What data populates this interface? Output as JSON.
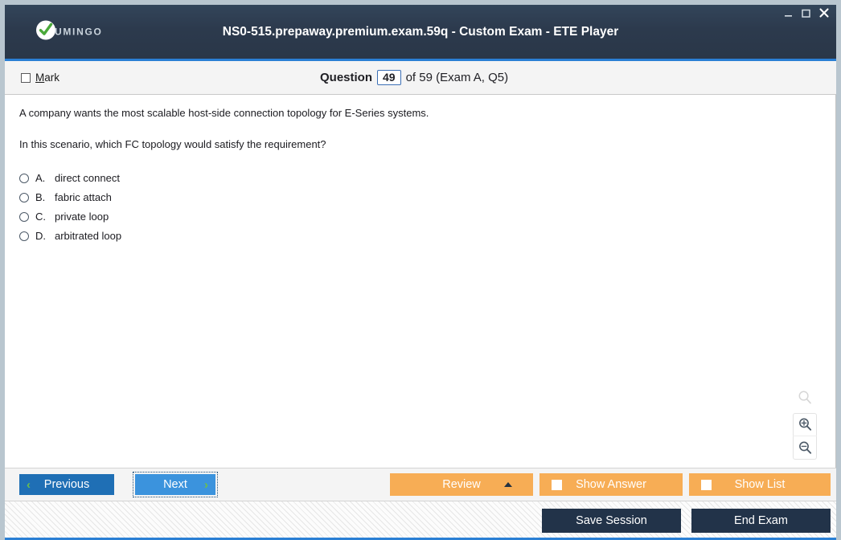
{
  "window": {
    "title": "NS0-515.prepaway.premium.exam.59q - Custom Exam - ETE Player",
    "brand_name": "UMINGO",
    "controls": {
      "minimize": "minimize-icon",
      "maximize": "maximize-icon",
      "close": "close-icon"
    },
    "accent_blue": "#2a7fd4",
    "titlebar_color": "#2c3a4d",
    "frame_color": "#b9c6cf"
  },
  "question_bar": {
    "mark_label_accel": "M",
    "mark_label_rest": "ark",
    "question_word": "Question",
    "question_number": "49",
    "question_of": "of 59 (Exam A, Q5)"
  },
  "question": {
    "stem": [
      "A company wants the most scalable host-side connection topology for E-Series systems.",
      "In this scenario, which FC topology would satisfy the requirement?"
    ],
    "choices": [
      {
        "letter": "A.",
        "text": "direct connect",
        "selected": false
      },
      {
        "letter": "B.",
        "text": "fabric attach",
        "selected": false
      },
      {
        "letter": "C.",
        "text": "private loop",
        "selected": false
      },
      {
        "letter": "D.",
        "text": "arbitrated loop",
        "selected": false
      }
    ]
  },
  "zoom_controls": {
    "reset": "magnifier-icon",
    "zoom_in": "zoom-in-icon",
    "zoom_out": "zoom-out-icon"
  },
  "action_bar": {
    "previous_label": "Previous",
    "next_label": "Next",
    "review_label": "Review",
    "show_answer_label": "Show Answer",
    "show_list_label": "Show List",
    "prev_chevron": "‹",
    "next_chevron": "›",
    "orange_color": "#f7ad55",
    "previous_color": "#1f6fb5",
    "next_color": "#3b93dd"
  },
  "footer": {
    "save_session_label": "Save Session",
    "end_exam_label": "End Exam",
    "dark_color": "#223349"
  }
}
